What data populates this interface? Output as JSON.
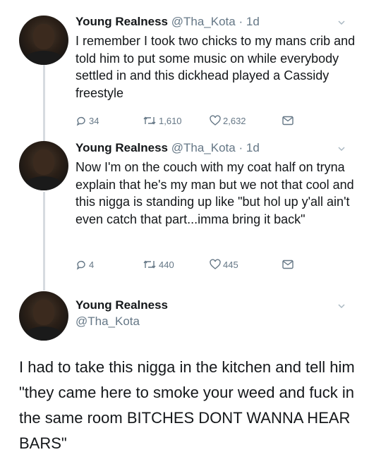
{
  "tweets": [
    {
      "name": "Young Realness",
      "handle": "@Tha_Kota",
      "separator": "·",
      "time": "1d",
      "text": "I remember I took two chicks to my mans crib and told him to put some music on while everybody settled in and this dickhead played a Cassidy freestyle",
      "replies": "34",
      "retweets": "1,610",
      "likes": "2,632"
    },
    {
      "name": "Young Realness",
      "handle": "@Tha_Kota",
      "separator": "·",
      "time": "1d",
      "text": "Now I'm on the couch with my coat half on tryna explain that he's my man but we not that cool and this nigga is standing up like \"but hol up y'all ain't even catch that part...imma bring it back\"",
      "replies": "4",
      "retweets": "440",
      "likes": "445"
    }
  ],
  "focused_tweet": {
    "name": "Young Realness",
    "handle": "@Tha_Kota",
    "text": "I had to take this nigga in the kitchen and tell him \"they came here to smoke your weed and fuck in the same room BITCHES DONT WANNA HEAR BARS\""
  },
  "icons": {
    "reply": "reply-icon",
    "retweet": "retweet-icon",
    "like": "heart-icon",
    "dm": "envelope-icon",
    "menu": "chevron-down-icon"
  },
  "colors": {
    "text": "#14171a",
    "muted": "#657786",
    "thread_line": "#d6dbe0"
  }
}
